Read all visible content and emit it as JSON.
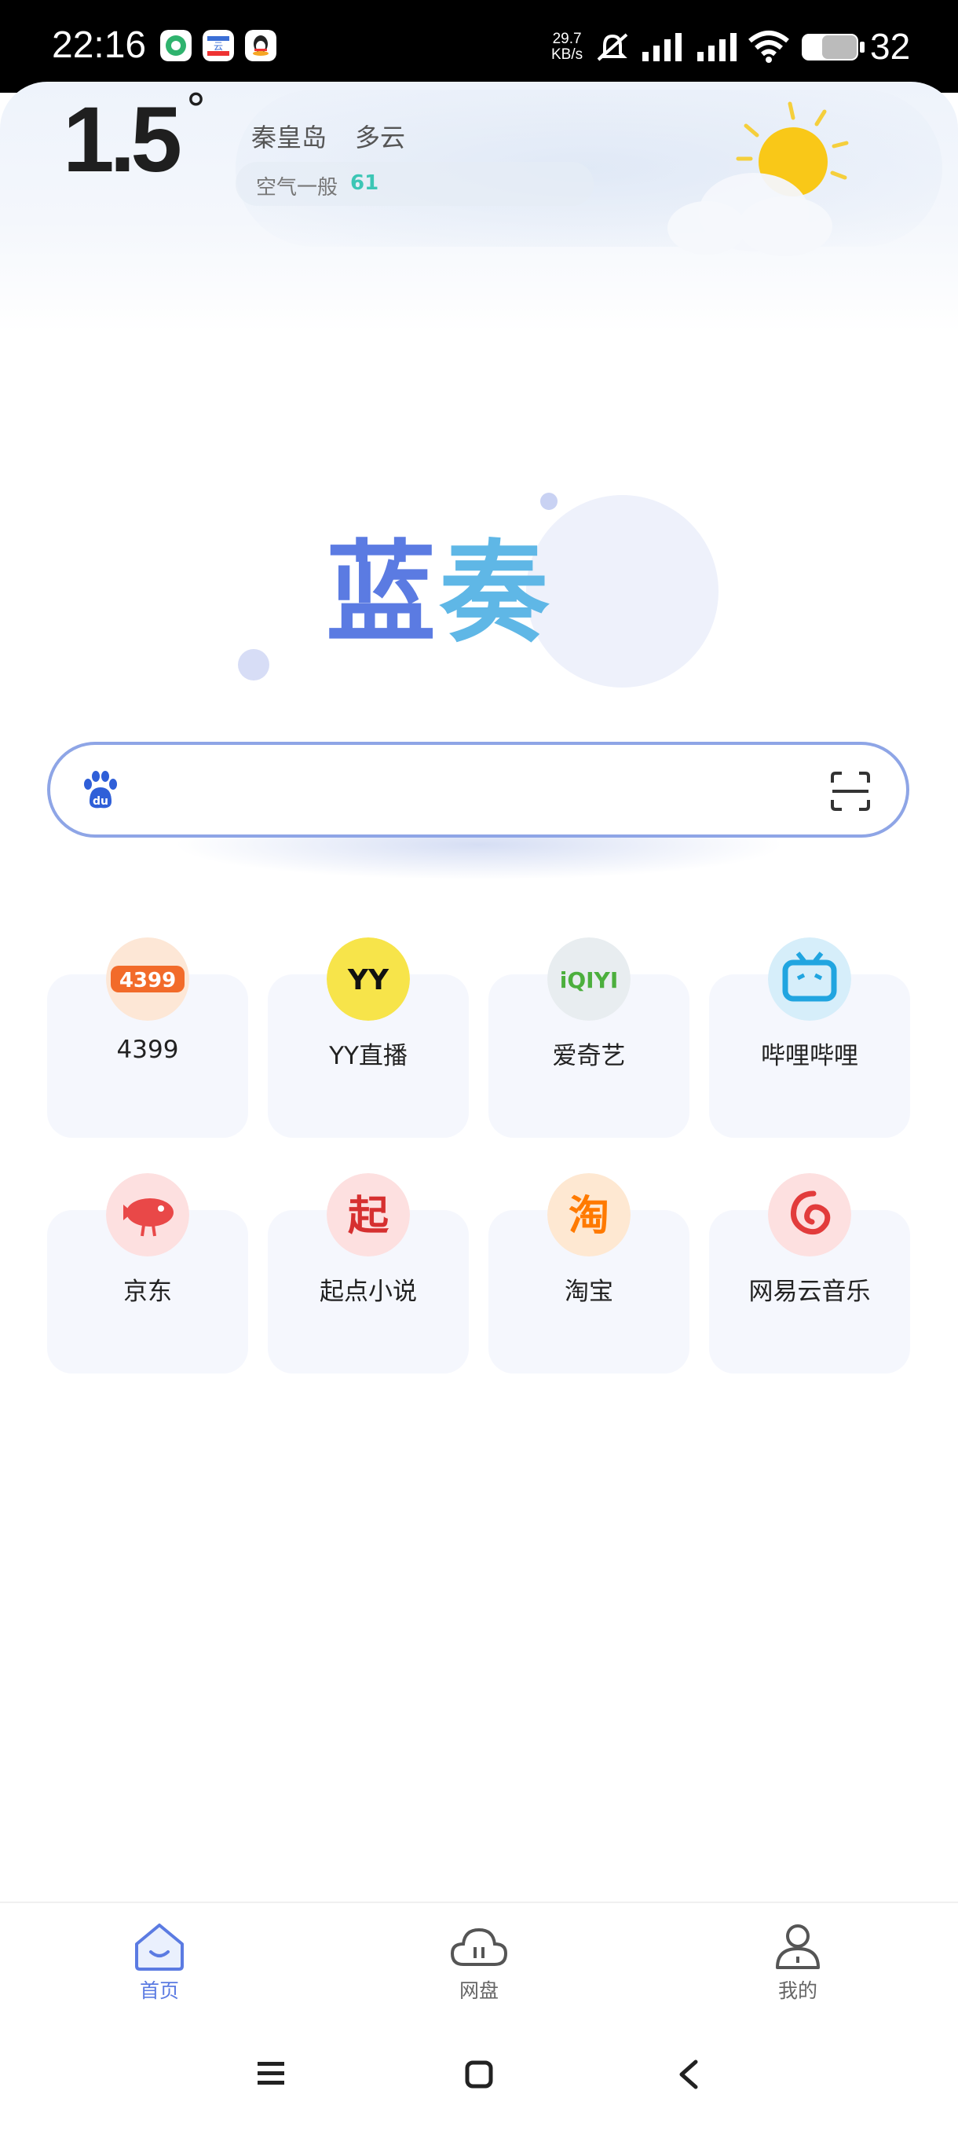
{
  "status_bar": {
    "time": "22:16",
    "net_speed_value": "29.7",
    "net_speed_unit": "KB/s",
    "battery": "32",
    "icons": [
      "green-app-icon",
      "calendar-app-icon",
      "qq-icon",
      "mute-icon",
      "signal-icon",
      "signal-icon",
      "wifi-icon",
      "battery-icon"
    ]
  },
  "weather": {
    "temperature": "1.5",
    "degree_symbol": "°",
    "city": "秦皇岛",
    "condition": "多云",
    "air_quality_label": "空气一般",
    "air_quality_value": "61"
  },
  "logo": {
    "char1": "蓝",
    "char2": "奏"
  },
  "search": {
    "value": "",
    "placeholder": "",
    "left_icon": "baidu-icon",
    "right_icon": "scan-icon"
  },
  "shortcuts": [
    {
      "label": "4399",
      "icon": "4399-icon",
      "color": "#f26b2a"
    },
    {
      "label": "YY直播",
      "icon": "yy-icon",
      "color": "#f7e44a"
    },
    {
      "label": "爱奇艺",
      "icon": "iqiyi-icon",
      "color": "#4caf3d"
    },
    {
      "label": "哔哩哔哩",
      "icon": "bilibili-icon",
      "color": "#21a5e0"
    },
    {
      "label": "京东",
      "icon": "jd-icon",
      "color": "#e94848"
    },
    {
      "label": "起点小说",
      "icon": "qidian-icon",
      "color": "#d63030"
    },
    {
      "label": "淘宝",
      "icon": "taobao-icon",
      "color": "#ff7a00"
    },
    {
      "label": "网易云音乐",
      "icon": "netease-music-icon",
      "color": "#e23c3c"
    }
  ],
  "bottom_nav": [
    {
      "label": "首页",
      "icon": "home-icon",
      "active": true
    },
    {
      "label": "网盘",
      "icon": "cloud-drive-icon",
      "active": false
    },
    {
      "label": "我的",
      "icon": "profile-icon",
      "active": false
    }
  ],
  "colors": {
    "accent": "#5b7be2",
    "search_border": "#8ea5e6",
    "aq_value": "#3cc6b5",
    "nav_inactive": "#666666"
  }
}
